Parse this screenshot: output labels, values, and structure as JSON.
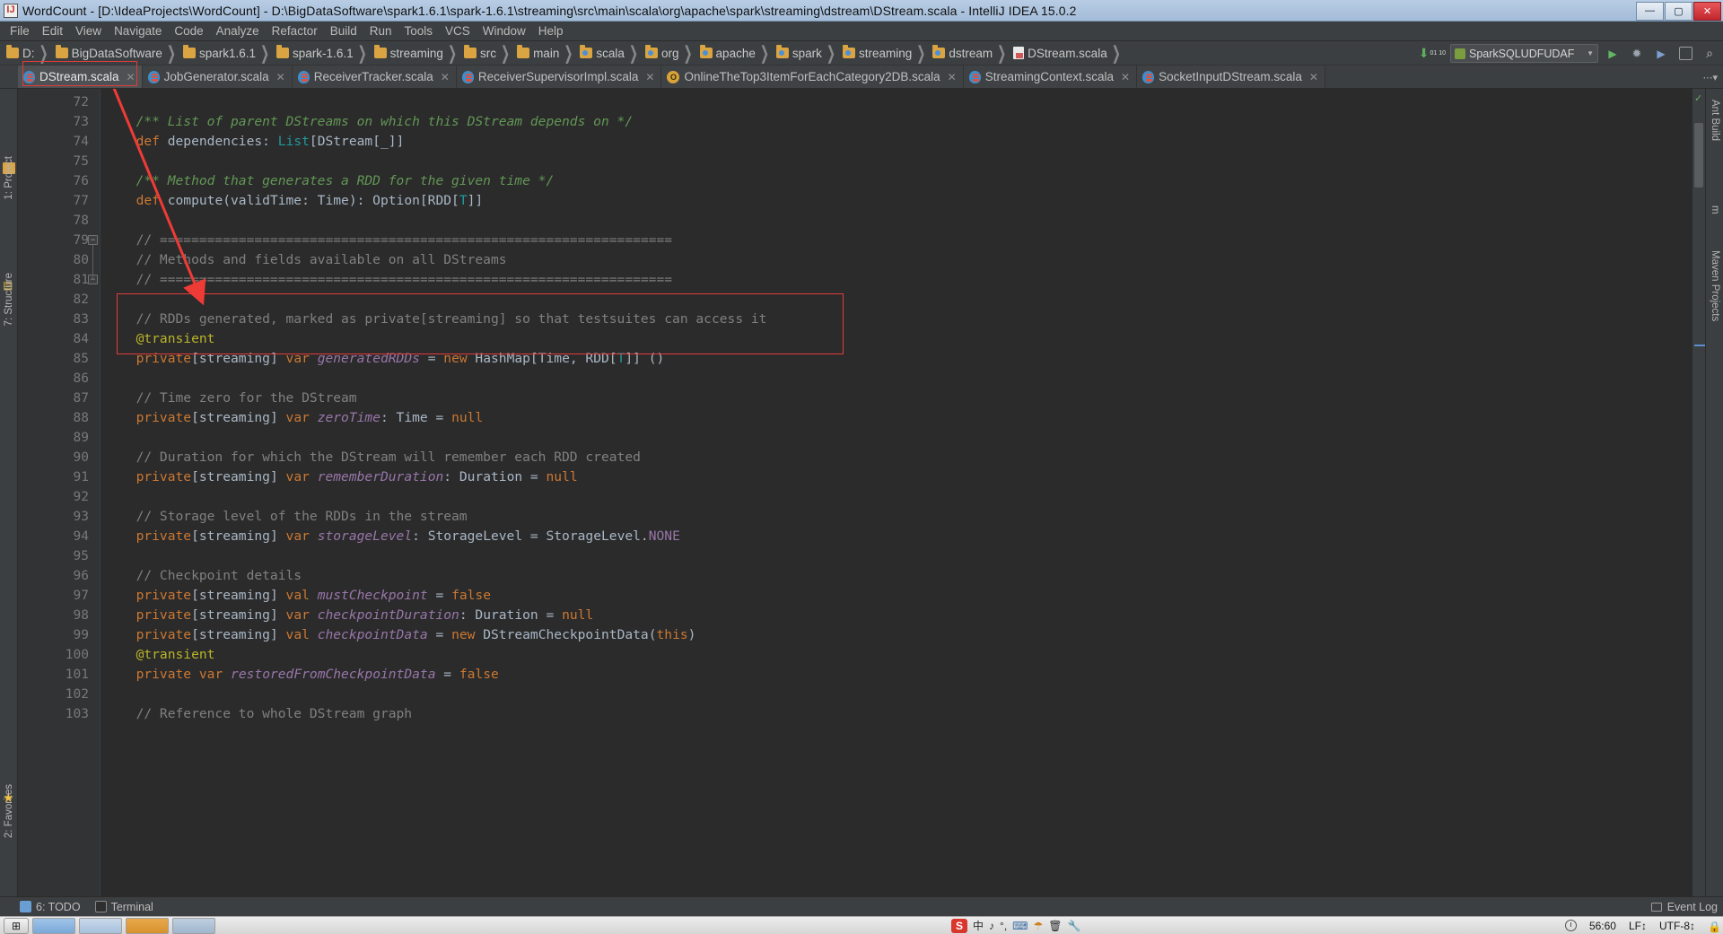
{
  "window": {
    "title": "WordCount - [D:\\IdeaProjects\\WordCount] - D:\\BigDataSoftware\\spark1.6.1\\spark-1.6.1\\streaming\\src\\main\\scala\\org\\apache\\spark\\streaming\\dstream\\DStream.scala - IntelliJ IDEA 15.0.2",
    "minimize": "—",
    "maximize": "▢",
    "close": "✕",
    "app_icon": "intellij-idea-icon"
  },
  "menu": {
    "items": [
      "File",
      "Edit",
      "View",
      "Navigate",
      "Code",
      "Analyze",
      "Refactor",
      "Build",
      "Run",
      "Tools",
      "VCS",
      "Window",
      "Help"
    ]
  },
  "navbar": {
    "crumbs": [
      {
        "label": "D:",
        "icon": "folder-icon"
      },
      {
        "label": "BigDataSoftware",
        "icon": "folder-icon"
      },
      {
        "label": "spark1.6.1",
        "icon": "folder-icon"
      },
      {
        "label": "spark-1.6.1",
        "icon": "folder-icon"
      },
      {
        "label": "streaming",
        "icon": "folder-icon"
      },
      {
        "label": "src",
        "icon": "folder-icon"
      },
      {
        "label": "main",
        "icon": "folder-icon"
      },
      {
        "label": "scala",
        "icon": "source-folder-icon"
      },
      {
        "label": "org",
        "icon": "source-folder-icon"
      },
      {
        "label": "apache",
        "icon": "source-folder-icon"
      },
      {
        "label": "spark",
        "icon": "source-folder-icon"
      },
      {
        "label": "streaming",
        "icon": "source-folder-icon"
      },
      {
        "label": "dstream",
        "icon": "source-folder-icon"
      },
      {
        "label": "DStream.scala",
        "icon": "scala-file-icon"
      }
    ],
    "separator": "❯",
    "download_badge": "01 10",
    "run_config": "SparkSQLUDFUDAF",
    "run_config_caret": "▼",
    "buttons": [
      {
        "name": "run-button",
        "glyph": "▶"
      },
      {
        "name": "debug-button",
        "glyph": "🐞"
      },
      {
        "name": "coverage-button",
        "glyph": "▶"
      },
      {
        "name": "settings-button",
        "glyph": "▣"
      },
      {
        "name": "search-button",
        "glyph": "🔍"
      }
    ]
  },
  "tabs": [
    {
      "label": "DStream.scala",
      "icon": "scala-class-icon",
      "active": true,
      "close": "✕"
    },
    {
      "label": "JobGenerator.scala",
      "icon": "scala-class-icon",
      "active": false,
      "close": "✕"
    },
    {
      "label": "ReceiverTracker.scala",
      "icon": "scala-class-icon",
      "active": false,
      "close": "✕"
    },
    {
      "label": "ReceiverSupervisorImpl.scala",
      "icon": "scala-class-icon",
      "active": false,
      "close": "✕"
    },
    {
      "label": "OnlineTheTop3ItemForEachCategory2DB.scala",
      "icon": "scala-object-icon",
      "active": false,
      "close": "✕"
    },
    {
      "label": "StreamingContext.scala",
      "icon": "scala-class-icon",
      "active": false,
      "close": "✕"
    },
    {
      "label": "SocketInputDStream.scala",
      "icon": "scala-class-icon",
      "active": false,
      "close": "✕"
    }
  ],
  "left_tool_window": {
    "project": "1: Project",
    "structure": "7: Structure",
    "favorites": "2: Favorites"
  },
  "right_tool_window": {
    "ant_build": "Ant Build",
    "maven_letter": "m",
    "maven_projects": "Maven Projects"
  },
  "editor": {
    "first_line": 72,
    "lines": [
      {
        "n": 72,
        "tokens": []
      },
      {
        "n": 73,
        "tokens": [
          {
            "t": "  /** List of parent DStreams on which this DStream depends on */",
            "c": "cm"
          }
        ]
      },
      {
        "n": 74,
        "tokens": [
          {
            "t": "  ",
            "c": "t"
          },
          {
            "t": "def",
            "c": "k"
          },
          {
            "t": " dependencies",
            "c": "t"
          },
          {
            "t": ": ",
            "c": "t"
          },
          {
            "t": "List",
            "c": "tp"
          },
          {
            "t": "[DStream[_]]",
            "c": "t"
          }
        ]
      },
      {
        "n": 75,
        "tokens": []
      },
      {
        "n": 76,
        "tokens": [
          {
            "t": "  /** Method that generates a RDD for the given time */",
            "c": "cm"
          }
        ]
      },
      {
        "n": 77,
        "tokens": [
          {
            "t": "  ",
            "c": "t"
          },
          {
            "t": "def",
            "c": "k"
          },
          {
            "t": " compute",
            "c": "t"
          },
          {
            "t": "(validTime: Time)",
            "c": "t"
          },
          {
            "t": ": Option[RDD[",
            "c": "t"
          },
          {
            "t": "T",
            "c": "tp"
          },
          {
            "t": "]]",
            "c": "t"
          }
        ]
      },
      {
        "n": 78,
        "tokens": []
      },
      {
        "n": 79,
        "tokens": [
          {
            "t": "  // =================================================================",
            "c": "c"
          }
        ]
      },
      {
        "n": 80,
        "tokens": [
          {
            "t": "  // Methods and fields available on all DStreams",
            "c": "c"
          }
        ]
      },
      {
        "n": 81,
        "tokens": [
          {
            "t": "  // =================================================================",
            "c": "c"
          }
        ]
      },
      {
        "n": 82,
        "tokens": []
      },
      {
        "n": 83,
        "tokens": [
          {
            "t": "  // RDDs generated, marked as private[streaming] so that testsuites can access it",
            "c": "c"
          }
        ]
      },
      {
        "n": 84,
        "tokens": [
          {
            "t": "  ",
            "c": "t"
          },
          {
            "t": "@transient",
            "c": "ann"
          }
        ]
      },
      {
        "n": 85,
        "tokens": [
          {
            "t": "  ",
            "c": "t"
          },
          {
            "t": "private",
            "c": "k"
          },
          {
            "t": "[streaming] ",
            "c": "t"
          },
          {
            "t": "var",
            "c": "k"
          },
          {
            "t": " ",
            "c": "t"
          },
          {
            "t": "generatedRDDs",
            "c": "fld"
          },
          {
            "t": " = ",
            "c": "t"
          },
          {
            "t": "new",
            "c": "k"
          },
          {
            "t": " HashMap[Time, RDD[",
            "c": "t"
          },
          {
            "t": "T",
            "c": "tp"
          },
          {
            "t": "]] ()",
            "c": "t"
          }
        ]
      },
      {
        "n": 86,
        "tokens": []
      },
      {
        "n": 87,
        "tokens": [
          {
            "t": "  // Time zero for the DStream",
            "c": "c"
          }
        ]
      },
      {
        "n": 88,
        "tokens": [
          {
            "t": "  ",
            "c": "t"
          },
          {
            "t": "private",
            "c": "k"
          },
          {
            "t": "[streaming] ",
            "c": "t"
          },
          {
            "t": "var",
            "c": "k"
          },
          {
            "t": " ",
            "c": "t"
          },
          {
            "t": "zeroTime",
            "c": "fld"
          },
          {
            "t": ": Time = ",
            "c": "t"
          },
          {
            "t": "null",
            "c": "k"
          }
        ]
      },
      {
        "n": 89,
        "tokens": []
      },
      {
        "n": 90,
        "tokens": [
          {
            "t": "  // Duration for which the DStream will remember each RDD created",
            "c": "c"
          }
        ]
      },
      {
        "n": 91,
        "tokens": [
          {
            "t": "  ",
            "c": "t"
          },
          {
            "t": "private",
            "c": "k"
          },
          {
            "t": "[streaming] ",
            "c": "t"
          },
          {
            "t": "var",
            "c": "k"
          },
          {
            "t": " ",
            "c": "t"
          },
          {
            "t": "rememberDuration",
            "c": "fld"
          },
          {
            "t": ": Duration = ",
            "c": "t"
          },
          {
            "t": "null",
            "c": "k"
          }
        ]
      },
      {
        "n": 92,
        "tokens": []
      },
      {
        "n": 93,
        "tokens": [
          {
            "t": "  // Storage level of the RDDs in the stream",
            "c": "c"
          }
        ]
      },
      {
        "n": 94,
        "tokens": [
          {
            "t": "  ",
            "c": "t"
          },
          {
            "t": "private",
            "c": "k"
          },
          {
            "t": "[streaming] ",
            "c": "t"
          },
          {
            "t": "var",
            "c": "k"
          },
          {
            "t": " ",
            "c": "t"
          },
          {
            "t": "storageLevel",
            "c": "fld"
          },
          {
            "t": ": StorageLevel = StorageLevel.",
            "c": "t"
          },
          {
            "t": "NONE",
            "c": "cn"
          }
        ]
      },
      {
        "n": 95,
        "tokens": []
      },
      {
        "n": 96,
        "tokens": [
          {
            "t": "  // Checkpoint details",
            "c": "c"
          }
        ]
      },
      {
        "n": 97,
        "tokens": [
          {
            "t": "  ",
            "c": "t"
          },
          {
            "t": "private",
            "c": "k"
          },
          {
            "t": "[streaming] ",
            "c": "t"
          },
          {
            "t": "val",
            "c": "k"
          },
          {
            "t": " ",
            "c": "t"
          },
          {
            "t": "mustCheckpoint",
            "c": "fld"
          },
          {
            "t": " = ",
            "c": "t"
          },
          {
            "t": "false",
            "c": "k"
          }
        ]
      },
      {
        "n": 98,
        "tokens": [
          {
            "t": "  ",
            "c": "t"
          },
          {
            "t": "private",
            "c": "k"
          },
          {
            "t": "[streaming] ",
            "c": "t"
          },
          {
            "t": "var",
            "c": "k"
          },
          {
            "t": " ",
            "c": "t"
          },
          {
            "t": "checkpointDuration",
            "c": "fld"
          },
          {
            "t": ": Duration = ",
            "c": "t"
          },
          {
            "t": "null",
            "c": "k"
          }
        ]
      },
      {
        "n": 99,
        "tokens": [
          {
            "t": "  ",
            "c": "t"
          },
          {
            "t": "private",
            "c": "k"
          },
          {
            "t": "[streaming] ",
            "c": "t"
          },
          {
            "t": "val",
            "c": "k"
          },
          {
            "t": " ",
            "c": "t"
          },
          {
            "t": "checkpointData",
            "c": "fld"
          },
          {
            "t": " = ",
            "c": "t"
          },
          {
            "t": "new",
            "c": "k"
          },
          {
            "t": " DStreamCheckpointData(",
            "c": "t"
          },
          {
            "t": "this",
            "c": "k"
          },
          {
            "t": ")",
            "c": "t"
          }
        ]
      },
      {
        "n": 100,
        "tokens": [
          {
            "t": "  ",
            "c": "t"
          },
          {
            "t": "@transient",
            "c": "ann"
          }
        ]
      },
      {
        "n": 101,
        "tokens": [
          {
            "t": "  ",
            "c": "t"
          },
          {
            "t": "private",
            "c": "k"
          },
          {
            "t": " ",
            "c": "t"
          },
          {
            "t": "var",
            "c": "k"
          },
          {
            "t": " ",
            "c": "t"
          },
          {
            "t": "restoredFromCheckpointData",
            "c": "fld"
          },
          {
            "t": " = ",
            "c": "t"
          },
          {
            "t": "false",
            "c": "k"
          }
        ]
      },
      {
        "n": 102,
        "tokens": []
      },
      {
        "n": 103,
        "tokens": [
          {
            "t": "  // Reference to whole DStream graph",
            "c": "c"
          }
        ]
      }
    ],
    "annotation": {
      "highlight_color": "#e33b3b",
      "highlight_lines": "83-85",
      "arrow": "red-arrow-annotation"
    }
  },
  "bottom_bar": {
    "todo": "6: TODO",
    "terminal": "Terminal",
    "event_log": "Event Log"
  },
  "status_bar": {
    "caret_position": "56:60",
    "line_separator": "LF↕",
    "encoding": "UTF-8↕",
    "lock": "lock-icon",
    "tray": [
      "S",
      "中",
      "♪",
      "°,",
      "⌨",
      "☂",
      "🗑",
      "🔧"
    ]
  }
}
